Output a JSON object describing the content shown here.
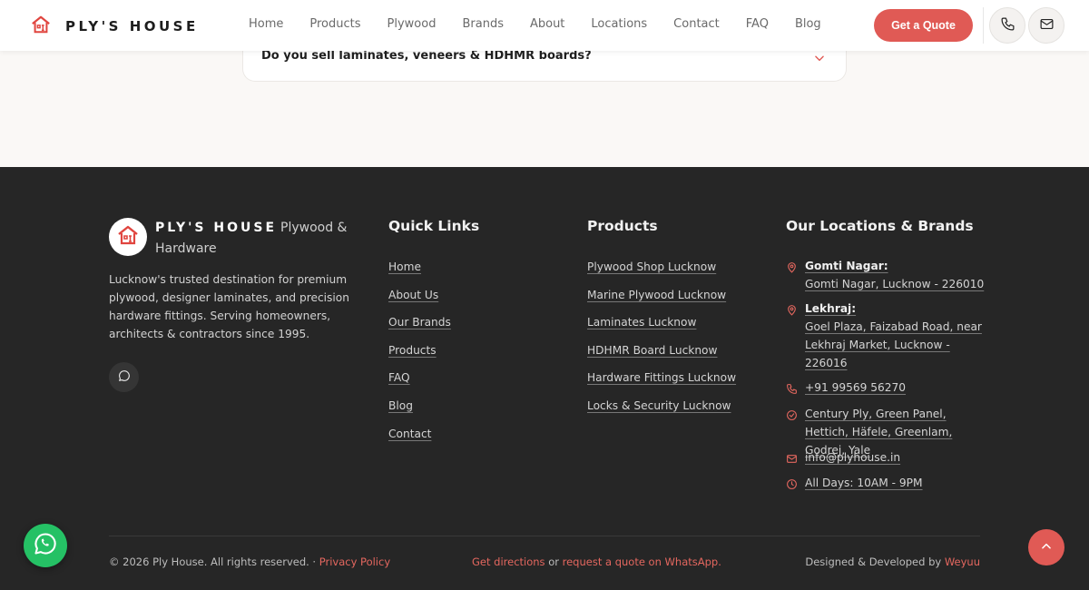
{
  "header": {
    "logo_text": "PLY'S HOUSE",
    "nav": [
      "Home",
      "Products",
      "Plywood",
      "Brands",
      "About",
      "Locations",
      "Contact",
      "FAQ",
      "Blog"
    ],
    "quote_label": "Get a Quote"
  },
  "faq": {
    "question": "Do you sell laminates, veneers & HDHMR boards?"
  },
  "footer": {
    "brand_name": "PLY'S HOUSE",
    "brand_tagline": "Plywood & Hardware",
    "description": "Lucknow's trusted destination for premium plywood, designer laminates, and precision hardware fittings. Serving homeowners, architects & contractors since 1995.",
    "quick_links_title": "Quick Links",
    "quick_links": [
      "Home",
      "About Us",
      "Our Brands",
      "Products",
      "FAQ",
      "Blog",
      "Contact"
    ],
    "products_title": "Products",
    "products": [
      "Plywood Shop Lucknow",
      "Marine Plywood Lucknow",
      "Laminates Lucknow",
      "HDHMR Board Lucknow",
      "Hardware Fittings Lucknow",
      "Locks & Security Lucknow"
    ],
    "locations_title": "Our Locations & Brands",
    "locations": {
      "gomti_label": "Gomti Nagar:",
      "gomti_address": "Gomti Nagar, Lucknow - 226010",
      "lekhraj_label": "Lekhraj:",
      "lekhraj_address": "Goel Plaza, Faizabad Road, near Lekhraj Market, Lucknow - 226016",
      "phone": "+91 99569 56270",
      "brands": "Century Ply, Green Panel, Hettich, Häfele, Greenlam, Godrej, Yale",
      "email": "info@plyhouse.in",
      "hours": "All Days: 10AM - 9PM"
    },
    "bottom": {
      "copyright": "© 2026 Ply House. All rights reserved. ·",
      "privacy": "Privacy Policy",
      "directions": "Get directions",
      "or": "or",
      "whatsapp_quote": "request a quote on WhatsApp.",
      "designed_by": "Designed & Developed by",
      "developer": "Weyuu"
    }
  },
  "colors": {
    "accent": "#e05a55",
    "footer_bg": "#262626",
    "whatsapp": "#25c165"
  },
  "icons": [
    "house-logo-icon",
    "phone-icon",
    "mail-icon",
    "chevron-down-icon",
    "chat-icon",
    "map-pin-icon",
    "check-circle-icon",
    "clock-icon",
    "whatsapp-icon",
    "chevron-up-icon"
  ]
}
